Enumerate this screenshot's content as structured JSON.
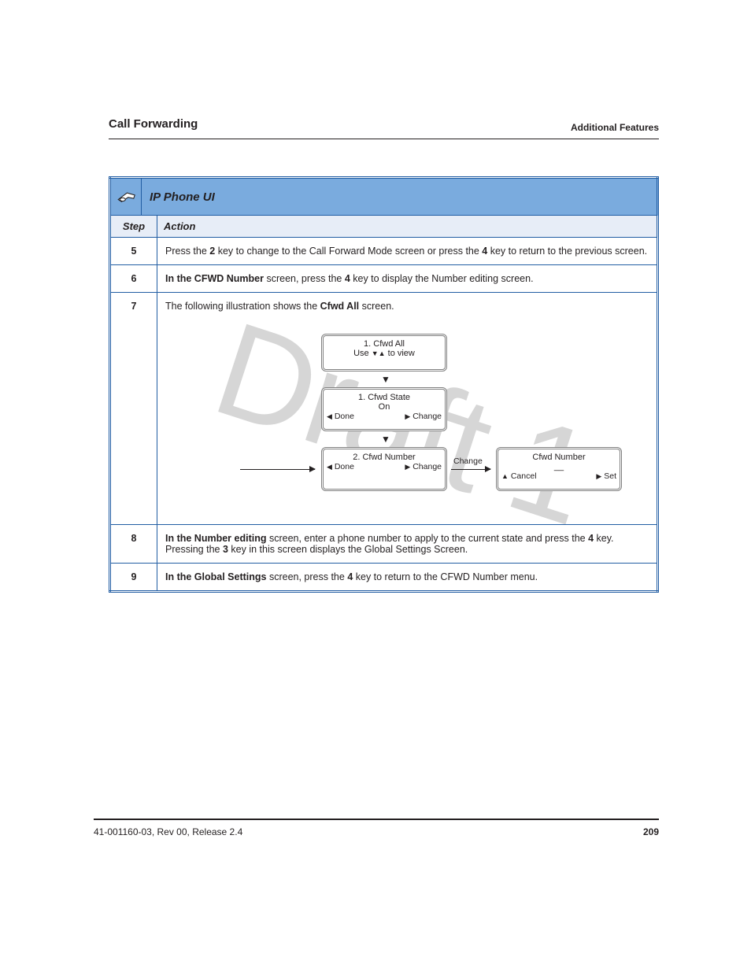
{
  "section": {
    "left": "Call Forwarding",
    "right": "Additional Features"
  },
  "header": {
    "title": "IP Phone UI"
  },
  "subheader": {
    "step": "Step",
    "action": "Action"
  },
  "rows": {
    "r5": {
      "n": "5",
      "text_a": "Press the ",
      "b1": "2",
      "text_b": " key to change to the Call Forward Mode screen or press the ",
      "b2": "4",
      "text_c": " key to return to the previous screen."
    },
    "r6": {
      "n": "6",
      "b1": "In the CFWD Number",
      "text_a": " screen, press the ",
      "b2": "4",
      "text_b": " key to display the Number editing screen."
    },
    "r7": {
      "n": "7",
      "text_a": "The following illustration shows the ",
      "b1": "Cfwd All",
      "text_b": " screen."
    },
    "r8": {
      "n": "8",
      "b1": "In the Number editing",
      "text_a": " screen, enter a phone number to apply to the current state and press the ",
      "b2": "4",
      "text_b": " key. Pressing the ",
      "b3": "3",
      "text_c": " key in this screen displays the Global Settings Screen."
    },
    "r9": {
      "n": "9",
      "b1": "In the Global Settings",
      "text_a": " screen, press the ",
      "b2": "4",
      "text_b": " key to return to the CFWD Number menu."
    }
  },
  "screens": {
    "s1": {
      "title": "1. Cfwd All",
      "line2a": "Use ",
      "line2b": " to view"
    },
    "s2": {
      "title": "1. Cfwd State",
      "line2": "On",
      "left": "Done",
      "right": "Change"
    },
    "s3": {
      "title": "2. Cfwd Number",
      "line2": "",
      "left": "Done",
      "right": "Change"
    },
    "s4": {
      "title": "Cfwd Number",
      "line2": "__",
      "left": "Cancel",
      "right": "Set"
    },
    "arrow_label": "Change"
  },
  "footer": {
    "left": "41-001160-03, Rev 00, Release 2.4",
    "right": "209"
  },
  "watermark": "Draft 1"
}
